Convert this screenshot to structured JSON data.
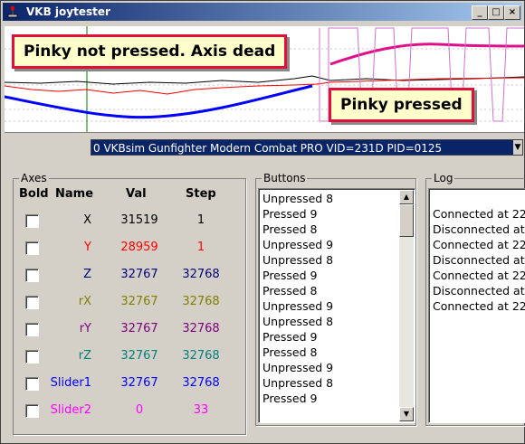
{
  "window": {
    "title": "VKB joytester",
    "minimize": "_",
    "maximize": "□",
    "close": "×"
  },
  "callouts": {
    "top": "Pinky not pressed. Axis dead",
    "bottom": "Pinky pressed",
    "border_color": "#e0103a"
  },
  "device_select": {
    "value": "0 VKBsim Gunfighter Modern Combat PRO  VID=231D PID=0125"
  },
  "axes": {
    "legend": "Axes",
    "headers": {
      "bold": "Bold",
      "name": "Name",
      "val": "Val",
      "step": "Step"
    },
    "rows": [
      {
        "name": "X",
        "val": "31519",
        "step": "1",
        "color": "#000000"
      },
      {
        "name": "Y",
        "val": "28959",
        "step": "1",
        "color": "#ff0000"
      },
      {
        "name": "Z",
        "val": "32767",
        "step": "32768",
        "color": "#000080"
      },
      {
        "name": "rX",
        "val": "32767",
        "step": "32768",
        "color": "#808000"
      },
      {
        "name": "rY",
        "val": "32767",
        "step": "32768",
        "color": "#800080"
      },
      {
        "name": "rZ",
        "val": "32767",
        "step": "32768",
        "color": "#008080"
      },
      {
        "name": "Slider1",
        "val": "32767",
        "step": "32768",
        "color": "#0000ff"
      },
      {
        "name": "Slider2",
        "val": "0",
        "step": "33",
        "color": "#ff00ff"
      }
    ]
  },
  "buttons": {
    "legend": "Buttons",
    "items": [
      "Unpressed 8",
      "Pressed 9",
      "Pressed 8",
      "Unpressed 9",
      "Unpressed 8",
      "Pressed 9",
      "Pressed 8",
      "Unpressed 9",
      "Unpressed 8",
      "Pressed 9",
      "Pressed 8",
      "Unpressed 9",
      "Unpressed 8",
      "Pressed 9"
    ]
  },
  "log": {
    "legend": "Log",
    "items": [
      "Connected at 22",
      "Disconnected at",
      "Connected at 22",
      "Disconnected at",
      "Connected at 22",
      "Disconnected at",
      "Connected at 22"
    ]
  },
  "graph_colors": {
    "x_axis": "#000000",
    "y_axis": "#ff0000",
    "slider1": "#0000ff",
    "slider2": "#ff00ff",
    "zero_marker": "#008000"
  }
}
